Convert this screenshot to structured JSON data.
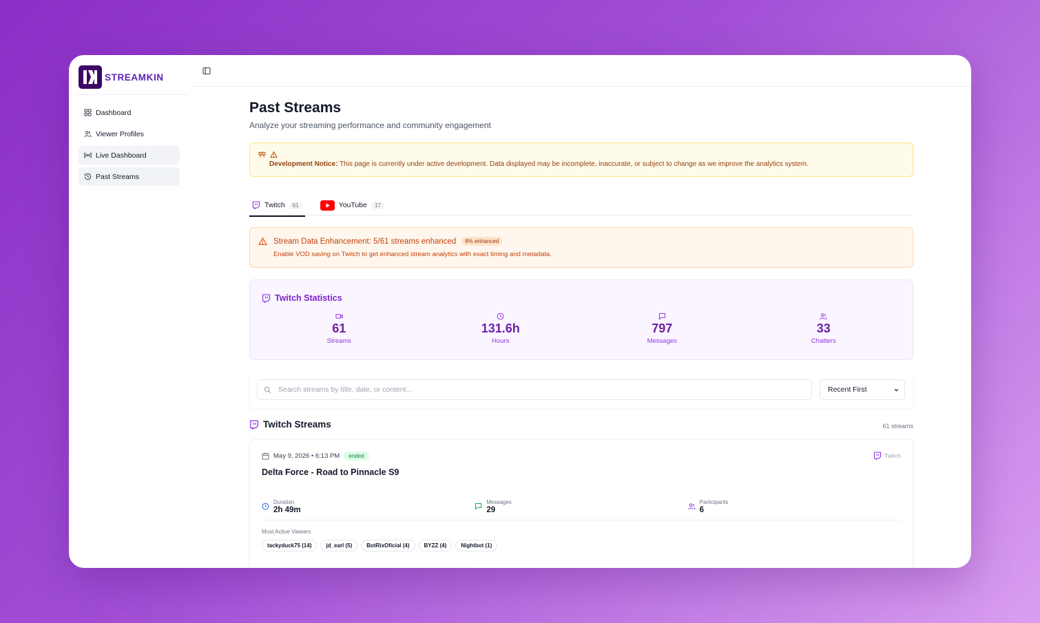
{
  "app": {
    "brand": "STREAMKIN"
  },
  "sidebar": {
    "items": [
      {
        "label": "Dashboard",
        "icon": "grid-icon"
      },
      {
        "label": "Viewer Profiles",
        "icon": "users-icon"
      },
      {
        "label": "Live Dashboard",
        "icon": "broadcast-icon"
      },
      {
        "label": "Past Streams",
        "icon": "history-icon"
      }
    ]
  },
  "page": {
    "title": "Past Streams",
    "subtitle": "Analyze your streaming performance and community engagement"
  },
  "dev_notice": {
    "label": "Development Notice:",
    "text": "This page is currently under active development. Data displayed may be incomplete, inaccurate, or subject to change as we improve the analytics system."
  },
  "tabs": [
    {
      "label": "Twitch",
      "count": "61"
    },
    {
      "label": "YouTube",
      "count": "17"
    }
  ],
  "enhancement": {
    "title": "Stream Data Enhancement: 5/61 streams enhanced",
    "badge": "8% enhanced",
    "text": "Enable VOD saving on Twitch to get enhanced stream analytics with exact timing and metadata."
  },
  "stats": {
    "title": "Twitch Statistics",
    "items": [
      {
        "value": "61",
        "label": "Streams",
        "icon": "video-icon"
      },
      {
        "value": "131.6h",
        "label": "Hours",
        "icon": "clock-icon"
      },
      {
        "value": "797",
        "label": "Messages",
        "icon": "message-icon"
      },
      {
        "value": "33",
        "label": "Chatters",
        "icon": "users-icon"
      }
    ]
  },
  "search": {
    "placeholder": "Search streams by title, date, or content...",
    "sort_value": "Recent First"
  },
  "streams": {
    "title": "Twitch Streams",
    "count_label": "61 streams",
    "items": [
      {
        "datetime": "May 9, 2026 • 6:13 PM",
        "status": "ended",
        "platform": "Twitch",
        "title": "Delta Force - Road to Pinnacle S9",
        "duration_label": "Duration",
        "duration": "2h 49m",
        "messages_label": "Messages",
        "messages": "29",
        "participants_label": "Participants",
        "participants": "6",
        "viewers_label": "Most Active Viewers",
        "viewers": [
          "tackyduck75 (14)",
          "jd_earl (5)",
          "BotRixOficial (4)",
          "BYZZ (4)",
          "Nightbot (1)"
        ]
      }
    ]
  },
  "colors": {
    "accent": "#7e22ce",
    "notice_text": "#92400e",
    "warning_text": "#c2410c",
    "status_green": "#15803d",
    "youtube_red": "#ff0000"
  }
}
